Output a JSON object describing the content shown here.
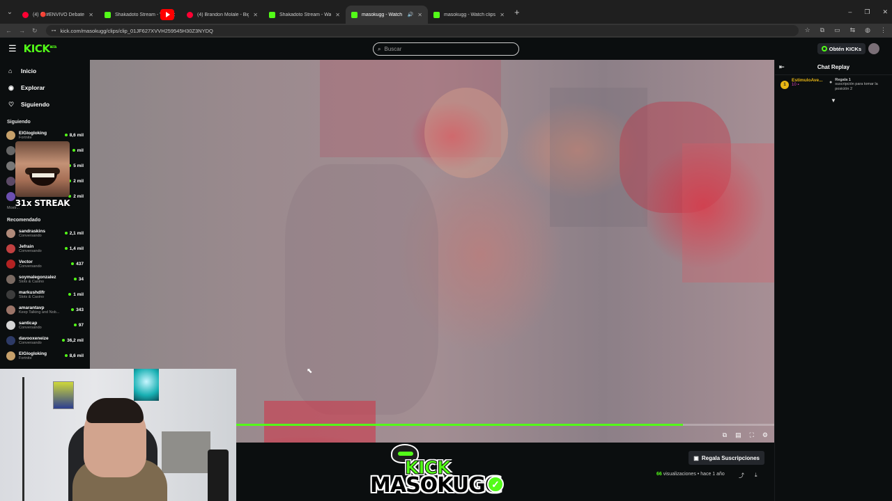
{
  "browser": {
    "tabs": [
      {
        "title": "(4) 🔴#ENVIVO Debate Presid...",
        "fav": "yt",
        "active": false
      },
      {
        "title": "Shakadoto Stream - Watch...",
        "fav": "k",
        "active": false
      },
      {
        "title": "(4) Brandon Molale - Big Stan...",
        "fav": "yt",
        "active": false
      },
      {
        "title": "Shakadoto Stream - Watch Live...",
        "fav": "k",
        "active": false
      },
      {
        "title": "masokugg - Watch clips on...",
        "fav": "k",
        "active": true
      },
      {
        "title": "masokugg - Watch clips on Kick",
        "fav": "k",
        "active": false
      }
    ],
    "url": "kick.com/masokugg/clips/clip_01JF627XVVH259545H30Z3NYDQ"
  },
  "header": {
    "logo": "KICK",
    "logo_beta": "BETA",
    "search_placeholder": "Buscar",
    "kicks_label": "Obtén KICKs"
  },
  "sidebar": {
    "nav": [
      {
        "icon": "⌂",
        "label": "Inicio",
        "name": "home"
      },
      {
        "icon": "◉",
        "label": "Explorar",
        "name": "explore"
      },
      {
        "icon": "♡",
        "label": "Siguiendo",
        "name": "following"
      }
    ],
    "following_title": "Siguiendo",
    "following": [
      {
        "name": "ElGlogloking",
        "cat": "Fortnite",
        "count": "8,6 mil",
        "color": "#c6a06a"
      },
      {
        "name": "",
        "cat": "",
        "count": "mil",
        "color": "#666"
      },
      {
        "name": "",
        "cat": "",
        "count": "5 mil",
        "color": "#777"
      },
      {
        "name": "",
        "cat": "",
        "count": "2 mil",
        "color": "#5c4a66"
      },
      {
        "name": "",
        "cat": "",
        "count": "2 mil",
        "color": "#6c4fb0"
      }
    ],
    "mostrar": "Mostr...",
    "sticker_caption": "31x STREAK",
    "recommended_title": "Recomendado",
    "recommended": [
      {
        "name": "sandraskins",
        "cat": "Conversando",
        "count": "2,1 mil",
        "color": "#b08a7a"
      },
      {
        "name": "Jefrain",
        "cat": "Conversando",
        "count": "1,4 mil",
        "color": "#c04040"
      },
      {
        "name": "Vector",
        "cat": "Conversando",
        "count": "437",
        "color": "#b32222"
      },
      {
        "name": "soymalegonzalez",
        "cat": "Slots & Casino",
        "count": "34",
        "color": "#7a6a62"
      },
      {
        "name": "markushdlfr",
        "cat": "Slots & Casino",
        "count": "1 mil",
        "color": "#3c3c3c"
      },
      {
        "name": "amarantavp",
        "cat": "Keep Talking and Nob...",
        "count": "343",
        "color": "#9b7468"
      },
      {
        "name": "santicap",
        "cat": "Conversando",
        "count": "97",
        "color": "#d5d5d5"
      },
      {
        "name": "davooxeneize",
        "cat": "Conversando",
        "count": "36,2 mil",
        "color": "#2d3a66"
      },
      {
        "name": "ElGlogloking",
        "cat": "Fortnite",
        "count": "8,6 mil",
        "color": "#c6a06a"
      }
    ]
  },
  "player": {
    "progress": 0.83
  },
  "chat": {
    "title": "Chat Replay",
    "gift": {
      "user": "EstimuloAve...",
      "count": "10",
      "cta_line1": "Regala 1",
      "cta_rest": "suscripción para tomar la posición 2"
    }
  },
  "below": {
    "gift_button": "Regala Suscripciones",
    "views_count": "66",
    "views_label": "visualizaciones",
    "time_ago": "hace 1 año",
    "brand_kick": "KICK",
    "brand_name": "MASOKUGG"
  },
  "colors": {
    "accent": "#53fc18",
    "bg": "#0b0e0f"
  }
}
